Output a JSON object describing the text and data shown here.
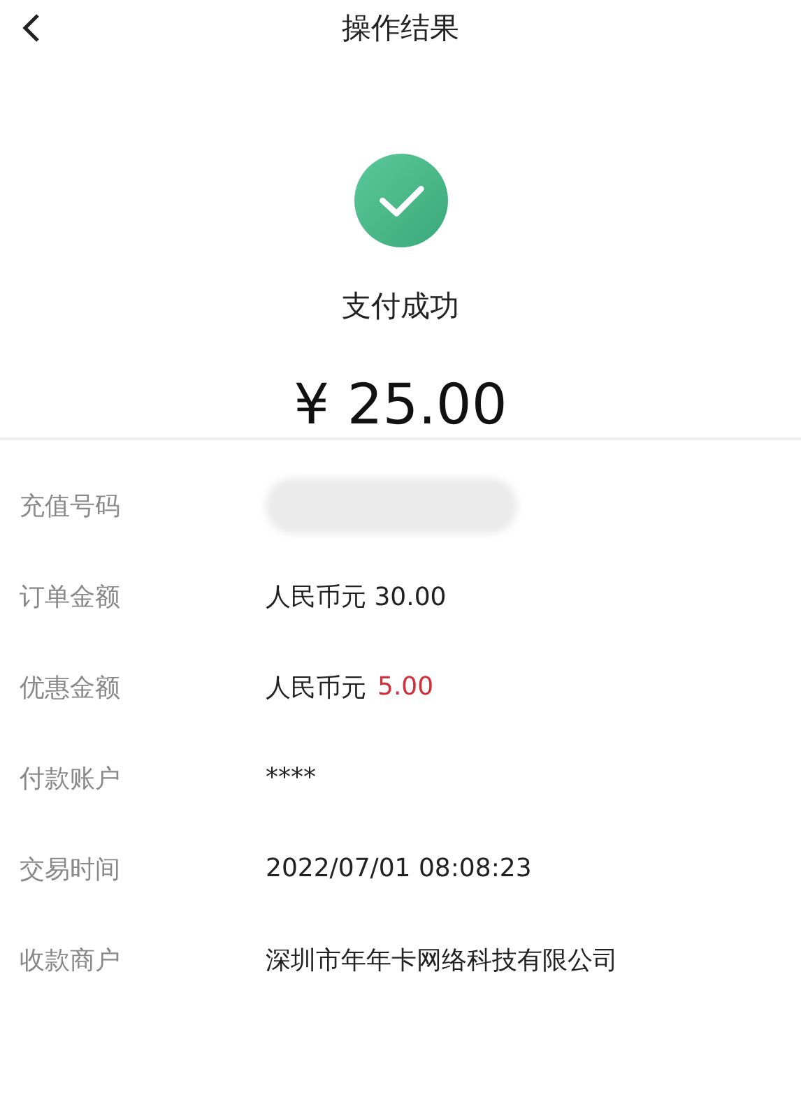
{
  "header": {
    "title": "操作结果"
  },
  "result": {
    "status": "支付成功",
    "amount": "¥ 25.00"
  },
  "details": [
    {
      "label": "充值号码",
      "kind": "redacted"
    },
    {
      "label": "订单金额",
      "kind": "text",
      "value": "人民币元 30.00"
    },
    {
      "label": "优惠金额",
      "kind": "text",
      "value": "人民币元",
      "accent": "5.00"
    },
    {
      "label": "付款账户",
      "kind": "text",
      "value": "****"
    },
    {
      "label": "交易时间",
      "kind": "text",
      "value": "2022/07/01 08:08:23"
    },
    {
      "label": "收款商户",
      "kind": "text",
      "value": "深圳市年年卡网络科技有限公司"
    }
  ]
}
